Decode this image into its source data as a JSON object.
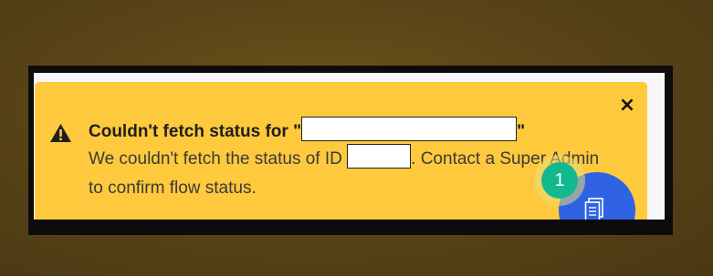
{
  "alert": {
    "title_prefix": "Couldn't fetch status for \"",
    "title_suffix": "\"",
    "body_prefix": "We couldn't fetch the status of ID ",
    "body_suffix": ". Contact a Super Admin to confirm flow status.",
    "close_label": "×",
    "icon": "warning-triangle-icon",
    "background_color": "#ffc93d"
  },
  "fab": {
    "icon": "document-icon",
    "color": "#2f63e3",
    "badge_count": "1",
    "badge_color": "#12b88e"
  }
}
